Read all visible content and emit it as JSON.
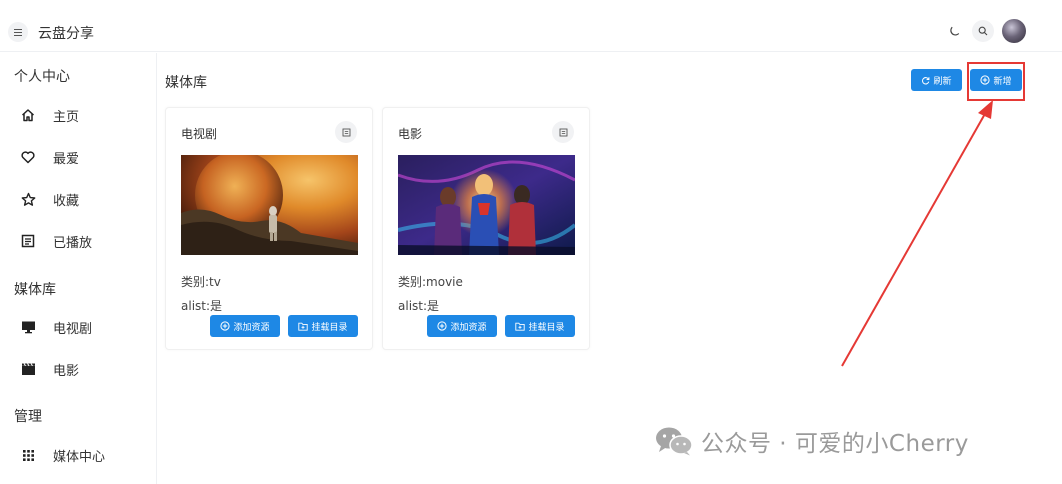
{
  "header": {
    "title": "云盘分享",
    "menu_icon": "menu-icon",
    "theme_icon": "moon-icon",
    "search_icon": "search-icon"
  },
  "sidebar": {
    "sections": [
      {
        "title": "个人中心",
        "items": [
          {
            "label": "主页",
            "icon": "home-icon"
          },
          {
            "label": "最爱",
            "icon": "heart-icon"
          },
          {
            "label": "收藏",
            "icon": "star-icon"
          },
          {
            "label": "已播放",
            "icon": "list-icon"
          }
        ]
      },
      {
        "title": "媒体库",
        "items": [
          {
            "label": "电视剧",
            "icon": "monitor-icon"
          },
          {
            "label": "电影",
            "icon": "clapperboard-icon"
          }
        ]
      },
      {
        "title": "管理",
        "items": [
          {
            "label": "媒体中心",
            "icon": "grid-icon"
          }
        ]
      }
    ]
  },
  "main": {
    "title": "媒体库",
    "refresh_label": "刷新",
    "add_label": "新增",
    "cards": [
      {
        "title": "电视剧",
        "type_label": "类别:",
        "type_value": "tv",
        "alist_label": "alist:",
        "alist_value": "是",
        "add_resource": "添加资源",
        "mount_dir": "挂载目录"
      },
      {
        "title": "电影",
        "type_label": "类别:",
        "type_value": "movie",
        "alist_label": "alist:",
        "alist_value": "是",
        "add_resource": "添加资源",
        "mount_dir": "挂载目录"
      }
    ]
  },
  "watermark": {
    "text": "公众号 · 可爱的小Cherry"
  },
  "colors": {
    "primary": "#1e88e5",
    "annotation": "#e53935",
    "border": "#eef0f3"
  }
}
